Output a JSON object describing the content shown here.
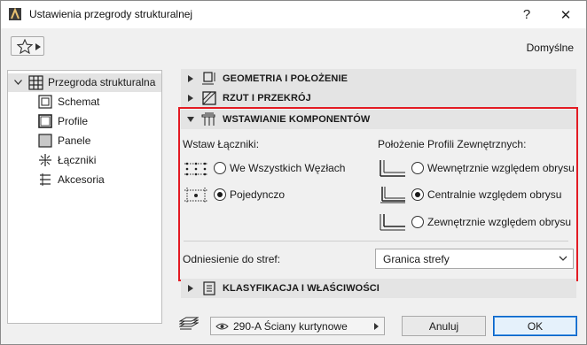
{
  "window": {
    "title": "Ustawienia przegrody strukturalnej",
    "help_label": "?",
    "close_label": "✕"
  },
  "toolbar": {
    "favorites_icon": "star-icon",
    "default_label": "Domyślne"
  },
  "tree": {
    "root": {
      "label": "Przegroda strukturalna",
      "icon": "grid-icon"
    },
    "items": [
      {
        "label": "Schemat",
        "icon": "schema-icon"
      },
      {
        "label": "Profile",
        "icon": "profile-icon"
      },
      {
        "label": "Panele",
        "icon": "panel-icon"
      },
      {
        "label": "Łączniki",
        "icon": "joint-icon"
      },
      {
        "label": "Akcesoria",
        "icon": "accessory-icon"
      }
    ]
  },
  "sections": {
    "geometry": {
      "title": "GEOMETRIA I POŁOŻENIE",
      "expanded": false
    },
    "plan": {
      "title": "RZUT I PRZEKRÓJ",
      "expanded": false
    },
    "components": {
      "title": "WSTAWIANIE KOMPONENTÓW",
      "expanded": true
    },
    "classification": {
      "title": "KLASYFIKACJA I WŁAŚCIWOŚCI",
      "expanded": false
    }
  },
  "components": {
    "joints_label": "Wstaw Łączniki:",
    "joint_options": [
      {
        "label": "We Wszystkich Węzłach",
        "checked": false
      },
      {
        "label": "Pojedynczo",
        "checked": true
      }
    ],
    "profile_label": "Położenie Profili Zewnętrznych:",
    "profile_options": [
      {
        "label": "Wewnętrznie względem obrysu",
        "checked": false
      },
      {
        "label": "Centralnie względem obrysu",
        "checked": true
      },
      {
        "label": "Zewnętrznie względem obrysu",
        "checked": false
      }
    ],
    "zone_label": "Odniesienie do stref:",
    "zone_value": "Granica strefy"
  },
  "footer": {
    "layer_value": "290-A Ściany kurtynowe",
    "cancel_label": "Anuluj",
    "ok_label": "OK"
  },
  "colors": {
    "highlight_border": "#e31b23",
    "section_bg": "#e4e4e4",
    "ok_border": "#0a64c8"
  }
}
